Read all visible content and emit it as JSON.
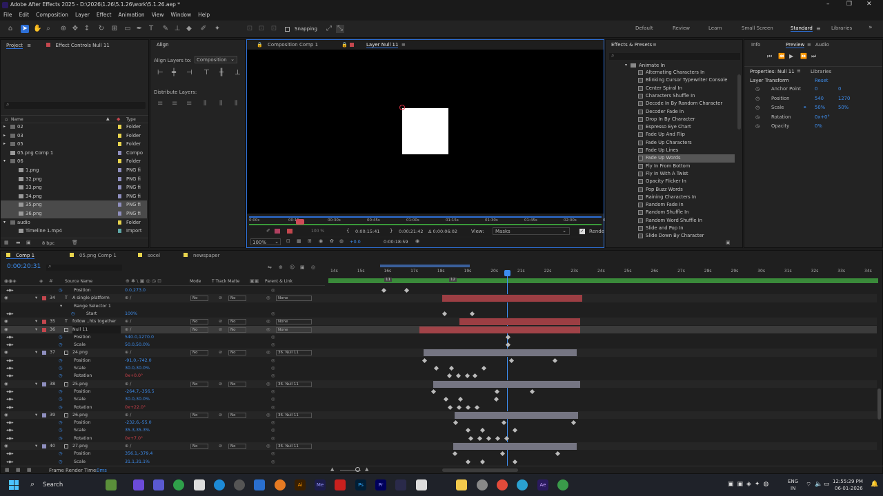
{
  "app": {
    "title": "Adobe After Effects 2025 - D:\\2026\\1.26\\5.1.26\\work\\5.1.26.aep *",
    "window_controls": [
      "–",
      "❐",
      "✕"
    ]
  },
  "menu": [
    "File",
    "Edit",
    "Composition",
    "Layer",
    "Effect",
    "Animation",
    "View",
    "Window",
    "Help"
  ],
  "toolbar": {
    "snapping_label": "Snapping",
    "workspaces": [
      "Default",
      "Review",
      "Learn",
      "Small Screen",
      "Standard",
      "Libraries"
    ]
  },
  "project": {
    "tab_project": "Project",
    "tab_effect_controls": "Effect Controls Null 11",
    "col_name": "Name",
    "col_type": "Type",
    "items": [
      {
        "name": "02",
        "type": "Folder",
        "color": "#e8d44d",
        "indent": 0
      },
      {
        "name": "03",
        "type": "Folder",
        "color": "#e8d44d",
        "indent": 0
      },
      {
        "name": "05",
        "type": "Folder",
        "color": "#e8d44d",
        "indent": 0
      },
      {
        "name": "05.png Comp 1",
        "type": "Compo",
        "color": "#8f8fbf",
        "indent": 0
      },
      {
        "name": "06",
        "type": "Folder",
        "color": "#e8d44d",
        "indent": 0
      },
      {
        "name": "1.png",
        "type": "PNG fi",
        "color": "#8f8fbf",
        "indent": 1
      },
      {
        "name": "32.png",
        "type": "PNG fi",
        "color": "#8f8fbf",
        "indent": 1
      },
      {
        "name": "33.png",
        "type": "PNG fi",
        "color": "#8f8fbf",
        "indent": 1
      },
      {
        "name": "34.png",
        "type": "PNG fi",
        "color": "#8f8fbf",
        "indent": 1
      },
      {
        "name": "35.png",
        "type": "PNG fi",
        "color": "#8f8fbf",
        "indent": 1,
        "selected": true
      },
      {
        "name": "36.png",
        "type": "PNG fi",
        "color": "#8f8fbf",
        "indent": 1,
        "selected": true
      },
      {
        "name": "audio",
        "type": "Folder",
        "color": "#e8d44d",
        "indent": 0
      },
      {
        "name": "Timeline 1.mp4",
        "type": "Import",
        "color": "#5fa8a8",
        "indent": 1
      }
    ],
    "bpc": "8 bpc"
  },
  "align": {
    "tab": "Align",
    "align_layers_to": "Align Layers to:",
    "align_target": "Composition",
    "distribute_layers": "Distribute Layers:"
  },
  "viewer": {
    "tab_comp": "Composition Comp 1",
    "tab_layer": "Layer Null 11",
    "ruler": [
      "0:00s",
      "00:15s",
      "00:30s",
      "00:45s",
      "01:00s",
      "01:15s",
      "01:30s",
      "01:45s",
      "02:00s",
      "02:15s"
    ],
    "zoom": "100%",
    "zoom2": "100 %",
    "in_point": "0:00:15:41",
    "out_point": "0:00:21:42",
    "duration": "Δ 0:00:06:02",
    "view_label": "View:",
    "view_value": "Masks",
    "render_label": "Rende",
    "offset": "+0.0",
    "time": "0:00:18:59"
  },
  "effects": {
    "tab": "Effects & Presets",
    "folder": "Animate In",
    "items": [
      "Alternating Characters In",
      "Blinking Cursor Typewriter Console",
      "Center Spiral In",
      "Characters Shuffle In",
      "Decode In By Random Character",
      "Decoder Fade In",
      "Drop In By Character",
      "Espresso Eye Chart",
      "Fade Up And Flip",
      "Fade Up Characters",
      "Fade Up Lines",
      "Fade Up Words",
      "Fly In From Bottom",
      "Fly In With A Twist",
      "Opacity Flicker In",
      "Pop Buzz Words",
      "Raining Characters In",
      "Random Fade In",
      "Random Shuffle In",
      "Random Word Shuffle In",
      "Slide and Pop In",
      "Slide Down By Character"
    ],
    "selected_index": 11
  },
  "right_panel": {
    "tabs": [
      "Info",
      "Preview",
      "Audio"
    ],
    "properties_title": "Properties: Null 11",
    "libraries": "Libraries",
    "section": "Layer Transform",
    "reset": "Reset",
    "props": [
      {
        "label": "Anchor Point",
        "v1": "0",
        "v2": "0"
      },
      {
        "label": "Position",
        "v1": "540",
        "v2": "1270"
      },
      {
        "label": "Scale",
        "v1": "50%",
        "v2": "50%"
      },
      {
        "label": "Rotation",
        "v1": "0x+0°",
        "v2": ""
      },
      {
        "label": "Opacity",
        "v1": "0%",
        "v2": ""
      }
    ]
  },
  "timeline": {
    "tabs": [
      "Comp 1",
      "05.png Comp 1",
      "socel",
      "newspaper"
    ],
    "current_time": "0:00:20:31",
    "col_source": "Source Name",
    "col_mode": "Mode",
    "col_trkmat": "T  Track Matte",
    "col_parent": "Parent & Link",
    "ruler": [
      "14s",
      "15s",
      "16s",
      "17s",
      "18s",
      "19s",
      "20s",
      "21s",
      "22s",
      "23s",
      "24s",
      "25s",
      "26s",
      "27s",
      "28s",
      "29s",
      "30s",
      "31s",
      "32s",
      "33s",
      "34s"
    ],
    "marker_labels": [
      "11",
      "12"
    ],
    "footer": "Frame Render Time:",
    "footer_value": "0ms",
    "rows": [
      {
        "type": "prop",
        "name": "Position",
        "value": "0.0,273.0"
      },
      {
        "type": "layer",
        "num": "34",
        "name": "A single platform",
        "label": "T",
        "mode": "No",
        "mat": "No",
        "parent": "None",
        "color": "#c4474e"
      },
      {
        "type": "sub",
        "name": "Range Selector 1"
      },
      {
        "type": "prop",
        "name": "Start",
        "value": "100%",
        "indent": 2
      },
      {
        "type": "layer",
        "num": "35",
        "name": "follow ..hts together",
        "label": "T",
        "mode": "No",
        "mat": "No",
        "parent": "None",
        "color": "#c4474e"
      },
      {
        "type": "layer",
        "num": "36",
        "name": "Null 11",
        "label": "",
        "mode": "No",
        "mat": "No",
        "parent": "None",
        "color": "#c4474e",
        "selected": true
      },
      {
        "type": "prop",
        "name": "Position",
        "value": "540.0,1270.0"
      },
      {
        "type": "prop",
        "name": "Scale",
        "value": "50.0,50.0%"
      },
      {
        "type": "layer",
        "num": "37",
        "name": "24.png",
        "label": "",
        "mode": "No",
        "mat": "No",
        "parent": "36. Null 11",
        "color": "#8f8fbf"
      },
      {
        "type": "prop",
        "name": "Position",
        "value": "-91.0,-742.0"
      },
      {
        "type": "prop",
        "name": "Scale",
        "value": "30.0,30.0%"
      },
      {
        "type": "prop",
        "name": "Rotation",
        "value": "0x+0.0°",
        "red": true
      },
      {
        "type": "layer",
        "num": "38",
        "name": "25.png",
        "label": "",
        "mode": "No",
        "mat": "No",
        "parent": "36. Null 11",
        "color": "#8f8fbf"
      },
      {
        "type": "prop",
        "name": "Position",
        "value": "-264.7,-356.5"
      },
      {
        "type": "prop",
        "name": "Scale",
        "value": "30.0,30.0%"
      },
      {
        "type": "prop",
        "name": "Rotation",
        "value": "0x+22.0°",
        "red": true
      },
      {
        "type": "layer",
        "num": "39",
        "name": "26.png",
        "label": "",
        "mode": "No",
        "mat": "No",
        "parent": "36. Null 11",
        "color": "#8f8fbf"
      },
      {
        "type": "prop",
        "name": "Position",
        "value": "-232.6,-55.0"
      },
      {
        "type": "prop",
        "name": "Scale",
        "value": "35.3,35.3%"
      },
      {
        "type": "prop",
        "name": "Rotation",
        "value": "0x+7.0°",
        "red": true
      },
      {
        "type": "layer",
        "num": "40",
        "name": "27.png",
        "label": "",
        "mode": "No",
        "mat": "No",
        "parent": "36. Null 11",
        "color": "#8f8fbf"
      },
      {
        "type": "prop",
        "name": "Position",
        "value": "356.1,-379.4"
      },
      {
        "type": "prop",
        "name": "Scale",
        "value": "31.1,31.1%"
      }
    ]
  },
  "taskbar": {
    "search": "Search",
    "lang": "ENG",
    "region": "IN",
    "time": "12:55:29 PM",
    "date": "06-01-2026"
  }
}
